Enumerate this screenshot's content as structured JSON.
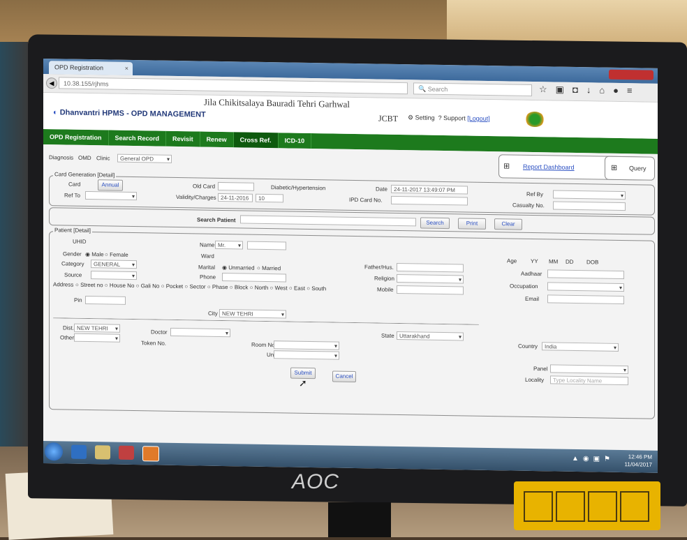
{
  "browser": {
    "tab_label": "OPD Registration",
    "tab_close": "×",
    "url": "10.38.155/rjhms",
    "search_placeholder": "Search",
    "toolbar_icons": [
      "star-icon",
      "bookmark-icon",
      "pocket-icon",
      "download-icon",
      "home-icon",
      "menu-icon"
    ]
  },
  "app": {
    "hospital_title": "Jila Chikitsalaya Bauradi Tehri Garhwal",
    "name": "Dhanvantri HPMS - OPD MANAGEMENT",
    "jcbt": "JCBT",
    "setting_link": "Setting",
    "support_label": "Support",
    "logout_link": "[Logout]"
  },
  "nav": {
    "items": [
      "OPD Registration",
      "Search Record",
      "Revisit",
      "Renew",
      "Cross Ref.",
      "ICD-10"
    ],
    "active_index": 4
  },
  "top_bar": {
    "diagnosis_label": "Diagnosis",
    "opd_label": "OMD",
    "clinic_label": "Clinic",
    "clinic_value": "General OPD",
    "report_dashboard": "Report Dashboard",
    "query": "Query"
  },
  "card_generation": {
    "legend": "Card Generation [Detail]",
    "card_label": "Card",
    "card_btn": "Annual",
    "ref_to_label": "Ref To",
    "old_card_label": "Old Card",
    "validity_label": "Validity/Charges",
    "validity_value": "24-11-2016",
    "charges_value": "10",
    "diabetic_label": "Diabetic/Hypertension",
    "date_label": "Date",
    "date_value": "24-11-2017  13:49:07 PM",
    "ipd_label": "IPD Card No.",
    "ref_by_label": "Ref By",
    "casualty_label": "Casualty No."
  },
  "search": {
    "label": "Search Patient",
    "search_btn": "Search",
    "print_btn": "Print",
    "clear_btn": "Clear"
  },
  "patient": {
    "legend": "Patient [Detail]",
    "uhid_label": "UHID",
    "gender_label": "Gender",
    "gender_options": [
      "Male",
      "Female"
    ],
    "category_label": "Category",
    "category_value": "GENERAL",
    "source_label": "Source",
    "address_label": "Address",
    "address_options": [
      "Street no",
      "House No",
      "Gali No",
      "Pocket",
      "Sector",
      "Phase",
      "Block",
      "North",
      "West",
      "East",
      "South"
    ],
    "pin_label": "Pin",
    "name_label": "Name",
    "name_title": "Mr.",
    "ward_label": "Ward",
    "marital_label": "Marital",
    "marital_options": [
      "Unmarried",
      "Married"
    ],
    "phone_label": "Phone",
    "city_label": "City",
    "city_value": "NEW TEHRI",
    "father_label": "Father/Hus.",
    "religion_label": "Religion",
    "mobile_label": "Mobile",
    "age_label": "Age",
    "age_yy": "YY",
    "age_mm": "MM",
    "age_dd": "DD",
    "dob_label": "DOB",
    "aadhaar_label": "Aadhaar",
    "occupation_label": "Occupation",
    "email_label": "Email",
    "dist_label": "Dist.",
    "dist_value": "NEW TEHRI",
    "state_label": "State",
    "state_value": "Uttarakhand",
    "country_label": "Country",
    "country_value": "India",
    "other_label": "Other",
    "doctor_label": "Doctor",
    "token_label": "Token No.",
    "room_label": "Room No.",
    "unit_label": "Unit",
    "panel_label": "Panel",
    "locality_label": "Locality",
    "locality_placeholder": "Type Locality Name"
  },
  "actions": {
    "submit": "Submit",
    "cancel": "Cancel"
  },
  "taskbar": {
    "time": "12:46 PM",
    "date": "11/04/2017"
  },
  "monitor": {
    "brand": "AOC"
  }
}
